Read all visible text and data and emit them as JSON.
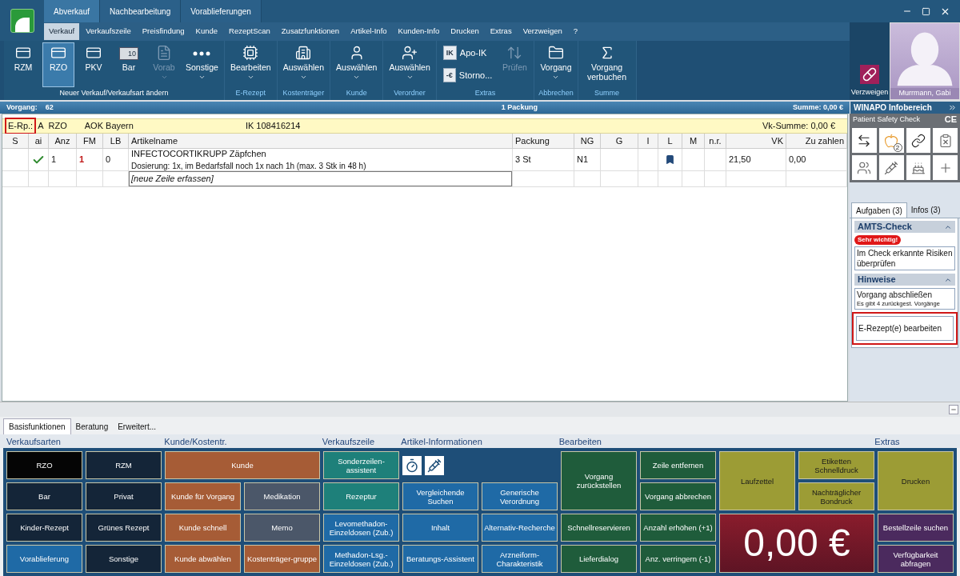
{
  "main_tabs": [
    {
      "label": "Abverkauf",
      "selected": true
    },
    {
      "label": "Nachbearbeitung",
      "selected": false
    },
    {
      "label": "Vorablieferungen",
      "selected": false
    }
  ],
  "sub_tabs": [
    {
      "label": "Verkauf",
      "selected": true
    },
    {
      "label": "Verkaufszeile",
      "selected": false
    },
    {
      "label": "Preisfindung",
      "selected": false
    },
    {
      "label": "Kunde",
      "selected": false
    },
    {
      "label": "RezeptScan",
      "selected": false
    },
    {
      "label": "Zusatzfunktionen",
      "selected": false
    },
    {
      "label": "Artikel-Info",
      "selected": false
    },
    {
      "label": "Kunden-Info",
      "selected": false
    },
    {
      "label": "Drucken",
      "selected": false
    },
    {
      "label": "Extras",
      "selected": false
    },
    {
      "label": "Verzweigen",
      "selected": false
    },
    {
      "label": "?",
      "selected": false
    }
  ],
  "ribbon": [
    {
      "label": "Neuer Verkauf/Verkaufsart ändern",
      "buttons": [
        {
          "label": "RZM",
          "kind": "large",
          "selected": false,
          "disabled": false,
          "dropdown": false
        },
        {
          "label": "RZO",
          "kind": "large",
          "selected": true,
          "disabled": false,
          "dropdown": false
        },
        {
          "label": "PKV",
          "kind": "large",
          "selected": false,
          "disabled": false,
          "dropdown": false
        },
        {
          "label": "Bar",
          "kind": "large",
          "badge": "10",
          "selected": false,
          "disabled": false,
          "dropdown": false
        },
        {
          "label": "Vorab",
          "kind": "large",
          "selected": false,
          "disabled": true,
          "dropdown": true
        },
        {
          "label": "Sonstige",
          "kind": "large",
          "selected": false,
          "disabled": false,
          "dropdown": true
        }
      ]
    },
    {
      "label": "E-Rezept",
      "buttons": [
        {
          "label": "Bearbeiten",
          "kind": "large",
          "disabled": false,
          "dropdown": true
        }
      ]
    },
    {
      "label": "Kostenträger",
      "buttons": [
        {
          "label": "Auswählen",
          "kind": "large",
          "disabled": false,
          "dropdown": true
        }
      ]
    },
    {
      "label": "Kunde",
      "buttons": [
        {
          "label": "Auswählen",
          "kind": "large",
          "disabled": false,
          "dropdown": true
        }
      ]
    },
    {
      "label": "Verordner",
      "buttons": [
        {
          "label": "Auswählen",
          "kind": "large",
          "disabled": false,
          "dropdown": true
        }
      ]
    },
    {
      "label": "Extras",
      "buttons": [
        {
          "label": "Apo-IK",
          "kind": "small",
          "badge": "IK"
        },
        {
          "label": "Storno...",
          "kind": "small",
          "badge": "-€"
        },
        {
          "label": "Prüfen",
          "kind": "large",
          "disabled": true,
          "dropdown": false
        }
      ]
    },
    {
      "label": "Abbrechen",
      "buttons": [
        {
          "label": "Vorgang",
          "kind": "large",
          "disabled": false,
          "dropdown": true
        }
      ]
    },
    {
      "label": "Summe",
      "buttons": [
        {
          "label": "Vorgang verbuchen",
          "kind": "large",
          "disabled": false,
          "dropdown": false
        }
      ]
    }
  ],
  "verzweigen": {
    "label": "Verzweigen"
  },
  "user": {
    "name": "Murrmann, Gabi"
  },
  "status_bar": {
    "vorgang_label": "Vorgang:",
    "vorgang": "62",
    "packages": "1 Packung",
    "sum": "Summe: 0,00 €"
  },
  "prescription_bar": {
    "label": "E-Rp.:",
    "highlighted": true,
    "type": "A",
    "kind": "RZO",
    "insurer": "AOK Bayern",
    "ik": "IK 108416214",
    "vk_sum": "Vk-Summe: 0,00 €"
  },
  "table": {
    "columns": [
      "S",
      "ai",
      "Anz",
      "FM",
      "LB",
      "Artikelname",
      "Packung",
      "NG",
      "G",
      "I",
      "L",
      "M",
      "n.r.",
      "VK",
      "Zu zahlen"
    ],
    "rows": [
      {
        "checked": true,
        "anz": "1",
        "fm": "1",
        "lb": "0",
        "name": "INFECTOCORTIKRUPP Zäpfchen",
        "dosage": "Dosierung: 1x, im Bedarfsfall noch 1x nach 1h (max. 3 Stk in 48 h)",
        "packung": "3 St",
        "ng": "N1",
        "l_marked": true,
        "vk": "21,50",
        "zu_zahlen": "0,00"
      }
    ],
    "new_row_placeholder": "[neue Zeile erfassen]"
  },
  "info_panel": {
    "title": "WINAPO Infobereich",
    "safety_check": {
      "title": "Patient Safety Check",
      "mark": "CE",
      "badge": "2"
    },
    "tabs": [
      {
        "label": "Aufgaben (3)",
        "selected": true
      },
      {
        "label": "Infos (3)",
        "selected": false
      }
    ],
    "sections": [
      {
        "title": "AMTS-Check",
        "expanded": true,
        "items": [
          {
            "badge": "Sehr wichtig!",
            "text": "Im Check erkannte Risiken überprüfen",
            "highlighted": false
          }
        ]
      },
      {
        "title": "Hinweise",
        "expanded": true,
        "items": [
          {
            "text": "Vorgang abschließen",
            "sub": "Es gibt 4 zurückgest. Vorgänge",
            "highlighted": false
          },
          {
            "text": "E-Rezept(e) bearbeiten",
            "highlighted": true
          }
        ]
      }
    ]
  },
  "bottom": {
    "tabs": [
      {
        "label": "Basisfunktionen",
        "selected": true
      },
      {
        "label": "Beratung",
        "selected": false
      },
      {
        "label": "Erweitert...",
        "selected": false
      }
    ],
    "sections": [
      {
        "title": "Verkaufsarten",
        "buttons": [
          "RZO",
          "RZM",
          "Bar",
          "Privat",
          "Kinder-Rezept",
          "Grünes Rezept",
          "Vorablieferung",
          "Sonstige"
        ]
      },
      {
        "title": "Kunde/Kostentr.",
        "buttons": [
          "Kunde",
          "Kunde für Vorgang",
          "Medikation",
          "Kunde schnell",
          "Memo",
          "Kunde abwählen",
          "Kostenträger-gruppe"
        ]
      },
      {
        "title": "Verkaufszeile",
        "buttons": [
          "Sonderzeilen- assistent",
          "Rezeptur",
          "Levomethadon- Einzeldosen (Zub.)",
          "Methadon-Lsg.- Einzeldosen (Zub.)"
        ]
      },
      {
        "title": "Artikel-Informationen",
        "buttons": [
          "Vergleichende Suchen",
          "Generische Verordnung",
          "Inhalt",
          "Alternativ-Recherche",
          "Beratungs-Assistent",
          "Arzneiform-Charakteristik"
        ]
      },
      {
        "title": "Bearbeiten",
        "buttons": [
          "Vorgang zurückstellen",
          "Zeile entfernen",
          "Vorgang abbrechen",
          "Laufzettel",
          "Etiketten Schnelldruck",
          "Nachträglicher Bondruck",
          "Schnellreservieren",
          "Anzahl erhöhen (+1)",
          "Lieferdialog",
          "Anz. verringern (-1)"
        ],
        "total": "0,00 €"
      },
      {
        "title": "Extras",
        "buttons": [
          "Drucken",
          "Bestellzeile suchen",
          "Verfügbarkeit abfragen"
        ]
      }
    ]
  }
}
